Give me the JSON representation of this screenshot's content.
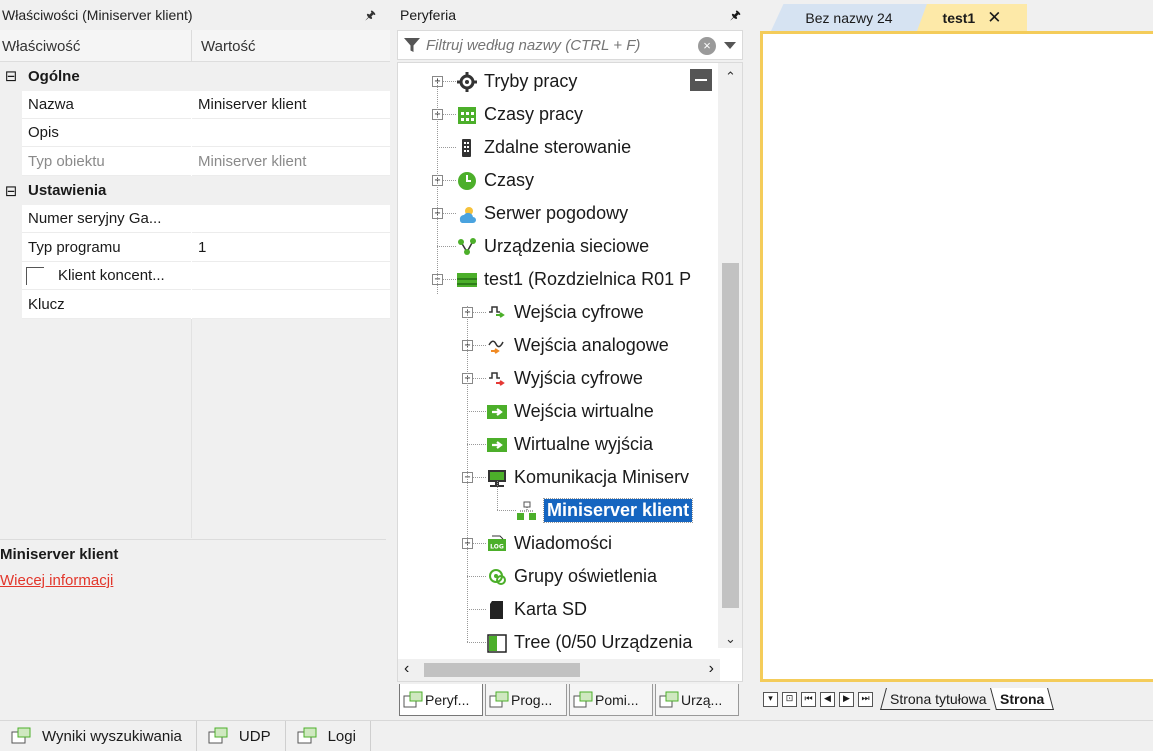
{
  "properties_panel": {
    "title": "Właściwości (Miniserver klient)",
    "pin": "🖈",
    "columns": {
      "property": "Właściwość",
      "value": "Wartość"
    },
    "categories": [
      {
        "label": "Ogólne",
        "toggle": "⊟",
        "rows": [
          {
            "name": "Nazwa",
            "value": "Miniserver klient",
            "readonly": false
          },
          {
            "name": "Opis",
            "value": "",
            "readonly": false
          },
          {
            "name": "Typ obiektu",
            "value": "Miniserver klient",
            "readonly": true
          }
        ]
      },
      {
        "label": "Ustawienia",
        "toggle": "⊟",
        "rows": [
          {
            "name": "Numer seryjny Ga...",
            "value": "",
            "readonly": false
          },
          {
            "name": "Typ programu",
            "value": "1",
            "readonly": false
          },
          {
            "name": "Klient koncent...",
            "value": "",
            "readonly": false,
            "checkbox": true
          },
          {
            "name": "Klucz",
            "value": "",
            "readonly": false
          }
        ]
      }
    ],
    "description": {
      "title": "Miniserver klient",
      "link": "Wiecej informacji"
    }
  },
  "peripherals_panel": {
    "title": "Peryferia",
    "pin": "🖈",
    "filter_placeholder": "Filtruj według nazwy (CTRL + F)",
    "clear": "×",
    "tree": [
      {
        "label": "Tryby pracy",
        "icon": "gear-icon",
        "level": 0,
        "expandable": true
      },
      {
        "label": "Czasy pracy",
        "icon": "calendar-icon",
        "level": 0,
        "expandable": true
      },
      {
        "label": "Zdalne sterowanie",
        "icon": "remote-icon",
        "level": 0,
        "expandable": false
      },
      {
        "label": "Czasy",
        "icon": "clock-icon",
        "level": 0,
        "expandable": true
      },
      {
        "label": "Serwer pogodowy",
        "icon": "weather-icon",
        "level": 0,
        "expandable": true
      },
      {
        "label": "Urządzenia sieciowe",
        "icon": "network-icon",
        "level": 0,
        "expandable": false
      },
      {
        "label": "test1 (Rozdzielnica R01 P",
        "icon": "miniserver-icon",
        "level": 0,
        "expandable": true,
        "expanded": true
      },
      {
        "label": "Wejścia cyfrowe",
        "icon": "digital-input-icon",
        "level": 1,
        "expandable": true
      },
      {
        "label": "Wejścia analogowe",
        "icon": "analog-input-icon",
        "level": 1,
        "expandable": true
      },
      {
        "label": "Wyjścia cyfrowe",
        "icon": "digital-output-icon",
        "level": 1,
        "expandable": true
      },
      {
        "label": "Wejścia wirtualne",
        "icon": "virtual-input-icon",
        "level": 1,
        "expandable": false
      },
      {
        "label": "Wirtualne wyjścia",
        "icon": "virtual-output-icon",
        "level": 1,
        "expandable": false
      },
      {
        "label": "Komunikacja Miniserv",
        "icon": "communication-icon",
        "level": 1,
        "expandable": true,
        "expanded": true
      },
      {
        "label": "Miniserver klient",
        "icon": "client-icon",
        "level": 2,
        "expandable": false,
        "selected": true
      },
      {
        "label": "Wiadomości",
        "icon": "log-icon",
        "level": 1,
        "expandable": true
      },
      {
        "label": "Grupy oświetlenia",
        "icon": "lighting-icon",
        "level": 1,
        "expandable": false
      },
      {
        "label": "Karta SD",
        "icon": "sd-card-icon",
        "level": 1,
        "expandable": false
      },
      {
        "label": "Tree  (0/50 Urządzenia",
        "icon": "tree-icon",
        "level": 1,
        "expandable": false
      }
    ],
    "tabs": [
      {
        "label": "Peryf...",
        "active": true
      },
      {
        "label": "Prog...",
        "active": false
      },
      {
        "label": "Pomi...",
        "active": false
      },
      {
        "label": "Urzą...",
        "active": false
      }
    ]
  },
  "document": {
    "tabs": [
      {
        "label": "Bez nazwy 24",
        "active": false
      },
      {
        "label": "test1",
        "active": true,
        "close": "✕"
      }
    ],
    "page_tabs": [
      {
        "label": "Strona tytułowa",
        "current": false
      },
      {
        "label": "Strona",
        "current": true
      }
    ],
    "nav_buttons": [
      "▾",
      "⊡",
      "⏮",
      "◀",
      "▶",
      "⏭"
    ]
  },
  "bottom_tabs": [
    {
      "label": "Wyniki wyszukiwania"
    },
    {
      "label": "UDP"
    },
    {
      "label": "Logi"
    }
  ],
  "colors": {
    "selection": "#1565c0",
    "active_tab": "#fde9a8",
    "inactive_tab": "#d6e3f2",
    "canvas_border": "#f4cc5a",
    "link": "#e2362b",
    "icon_green": "#4caf2a"
  }
}
